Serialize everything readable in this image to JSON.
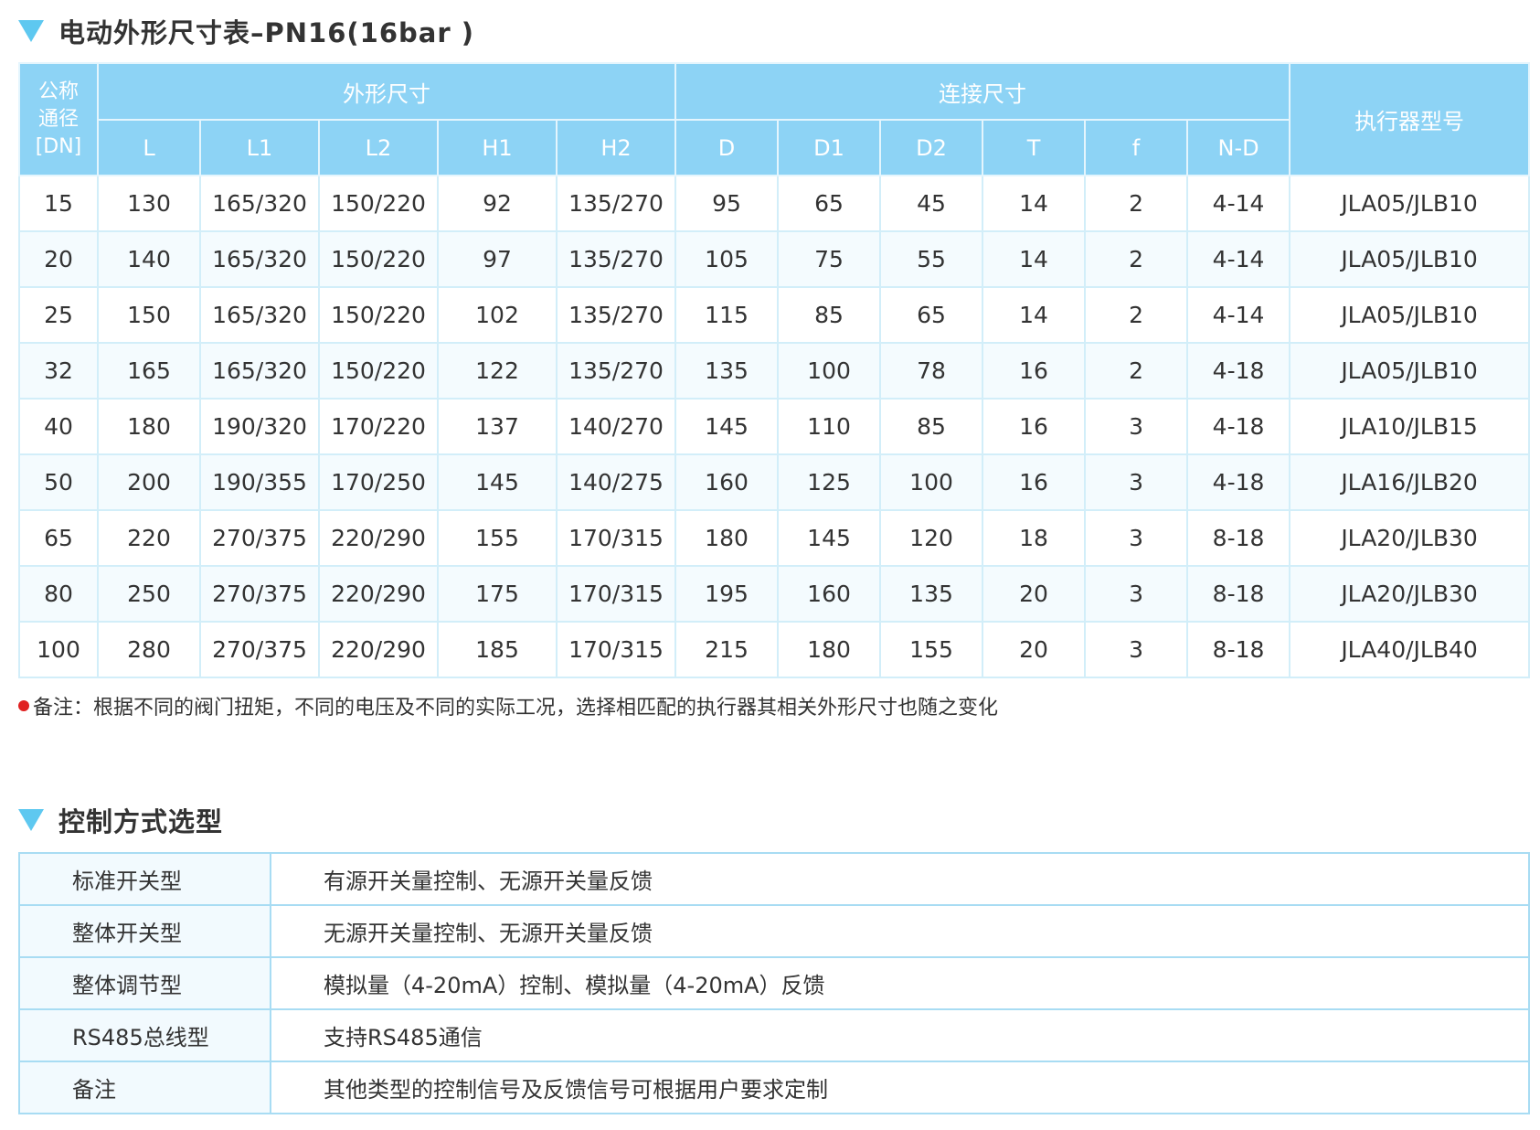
{
  "section1": {
    "title": "电动外形尺寸表–PN16(16bar )"
  },
  "dimension_table": {
    "header_dn": "公称\n通径\n[DN]",
    "group_outline": "外形尺寸",
    "group_connection": "连接尺寸",
    "header_actuator": "执行器型号",
    "columns": [
      "L",
      "L1",
      "L2",
      "H1",
      "H2",
      "D",
      "D1",
      "D2",
      "T",
      "f",
      "N-D"
    ],
    "rows": [
      [
        "15",
        "130",
        "165/320",
        "150/220",
        "92",
        "135/270",
        "95",
        "65",
        "45",
        "14",
        "2",
        "4-14",
        "JLA05/JLB10"
      ],
      [
        "20",
        "140",
        "165/320",
        "150/220",
        "97",
        "135/270",
        "105",
        "75",
        "55",
        "14",
        "2",
        "4-14",
        "JLA05/JLB10"
      ],
      [
        "25",
        "150",
        "165/320",
        "150/220",
        "102",
        "135/270",
        "115",
        "85",
        "65",
        "14",
        "2",
        "4-14",
        "JLA05/JLB10"
      ],
      [
        "32",
        "165",
        "165/320",
        "150/220",
        "122",
        "135/270",
        "135",
        "100",
        "78",
        "16",
        "2",
        "4-18",
        "JLA05/JLB10"
      ],
      [
        "40",
        "180",
        "190/320",
        "170/220",
        "137",
        "140/270",
        "145",
        "110",
        "85",
        "16",
        "3",
        "4-18",
        "JLA10/JLB15"
      ],
      [
        "50",
        "200",
        "190/355",
        "170/250",
        "145",
        "140/275",
        "160",
        "125",
        "100",
        "16",
        "3",
        "4-18",
        "JLA16/JLB20"
      ],
      [
        "65",
        "220",
        "270/375",
        "220/290",
        "155",
        "170/315",
        "180",
        "145",
        "120",
        "18",
        "3",
        "8-18",
        "JLA20/JLB30"
      ],
      [
        "80",
        "250",
        "270/375",
        "220/290",
        "175",
        "170/315",
        "195",
        "160",
        "135",
        "20",
        "3",
        "8-18",
        "JLA20/JLB30"
      ],
      [
        "100",
        "280",
        "270/375",
        "220/290",
        "185",
        "170/315",
        "215",
        "180",
        "155",
        "20",
        "3",
        "8-18",
        "JLA40/JLB40"
      ]
    ]
  },
  "note": "备注：根据不同的阀门扭矩，不同的电压及不同的实际工况，选择相匹配的执行器其相关外形尺寸也随之变化",
  "section2": {
    "title": "控制方式选型"
  },
  "control_table": {
    "rows": [
      {
        "type": "标准开关型",
        "desc": "有源开关量控制、无源开关量反馈"
      },
      {
        "type": "整体开关型",
        "desc": "无源开关量控制、无源开关量反馈"
      },
      {
        "type": "整体调节型",
        "desc": "模拟量（4-20mA）控制、模拟量（4-20mA）反馈"
      },
      {
        "type": "RS485总线型",
        "desc": "支持RS485通信"
      },
      {
        "type": "备注",
        "desc": "其他类型的控制信号及反馈信号可根据用户要求定制"
      }
    ]
  },
  "colors": {
    "header_blue": "#8dd3f5",
    "accent_triangle": "#5ec8f0",
    "note_dot": "#e02020"
  }
}
